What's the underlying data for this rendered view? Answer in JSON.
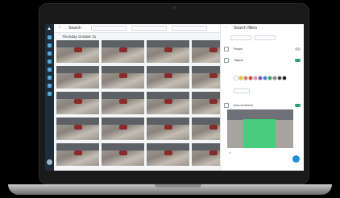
{
  "topbar": {
    "title": "Search",
    "field_1": "",
    "field_2": "",
    "field_3": ""
  },
  "grid": {
    "title": "Thursday October 31",
    "thumbs": [
      "",
      "",
      "",
      "",
      "",
      "",
      "",
      "",
      "",
      "",
      "",
      "",
      "",
      "",
      "",
      "",
      "",
      "",
      "",
      ""
    ]
  },
  "panel": {
    "title": "Search filters",
    "section_people": "People",
    "section_objects": "Objects",
    "section_area": "Area of interest"
  },
  "colors": {
    "accent": "#1e90d6",
    "rail": "#1f2d3a",
    "toggle_on": "#2f9e6e",
    "swatches": [
      "#ffffff",
      "#f4c542",
      "#e07b39",
      "#d9363e",
      "#e88fc6",
      "#8e44ad",
      "#2e86de",
      "#27ae60",
      "#7f8c8d",
      "#2c3e50",
      "#111111"
    ]
  }
}
